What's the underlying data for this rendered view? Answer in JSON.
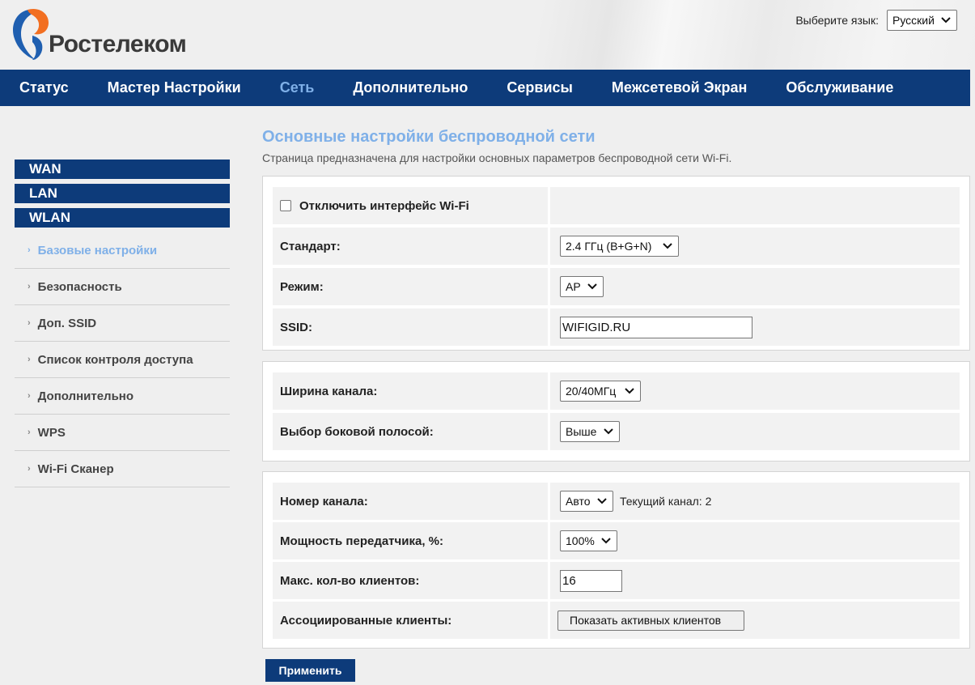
{
  "brand": {
    "logo_text": "Ростелеком",
    "colors": {
      "nav": "#0d3b7a",
      "accent": "#7fb0e8",
      "logo_orange": "#f26f21",
      "logo_blue": "#1f5fb0"
    }
  },
  "language": {
    "label": "Выберите язык:",
    "selected": "Русский"
  },
  "topnav": {
    "items": [
      {
        "label": "Статус"
      },
      {
        "label": "Мастер Настройки"
      },
      {
        "label": "Сеть",
        "active": true
      },
      {
        "label": "Дополнительно"
      },
      {
        "label": "Сервисы"
      },
      {
        "label": "Межсетевой Экран"
      },
      {
        "label": "Обслуживание"
      }
    ]
  },
  "sidebar": {
    "sections": [
      "WAN",
      "LAN",
      "WLAN"
    ],
    "items": [
      {
        "label": "Базовые настройки",
        "active": true
      },
      {
        "label": "Безопасность"
      },
      {
        "label": "Доп. SSID"
      },
      {
        "label": "Список контроля доступа"
      },
      {
        "label": "Дополнительно"
      },
      {
        "label": "WPS"
      },
      {
        "label": "Wi-Fi Сканер"
      }
    ]
  },
  "main": {
    "title": "Основные настройки беспроводной сети",
    "description": "Страница предназначена для настройки основных параметров беспроводной сети Wi-Fi.",
    "disable_wifi": {
      "label": "Отключить интерфейс Wi-Fi",
      "checked": false
    },
    "standard": {
      "label": "Стандарт:",
      "value": "2.4 ГГц (B+G+N)"
    },
    "mode": {
      "label": "Режим:",
      "value": "AP"
    },
    "ssid": {
      "label": "SSID:",
      "value": "WIFIGID.RU"
    },
    "channel_width": {
      "label": "Ширина канала:",
      "value": "20/40МГц"
    },
    "sideband": {
      "label": "Выбор боковой полосой:",
      "value": "Выше"
    },
    "channel": {
      "label": "Номер канала:",
      "value": "Авто",
      "current": "Текущий канал: 2"
    },
    "tx_power": {
      "label": "Мощность передатчика, %:",
      "value": "100%"
    },
    "max_clients": {
      "label": "Макс. кол-во клиентов:",
      "value": "16"
    },
    "assoc_clients": {
      "label": "Ассоциированные клиенты:",
      "button": "Показать активных клиентов"
    },
    "apply_label": "Применить"
  }
}
